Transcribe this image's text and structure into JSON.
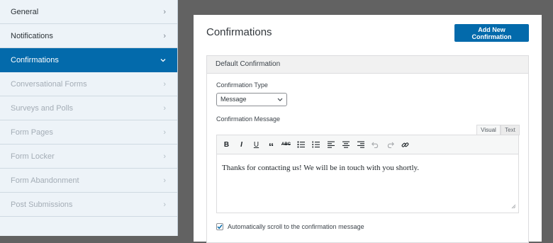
{
  "sidebar": {
    "items": [
      {
        "label": "General",
        "state": "normal"
      },
      {
        "label": "Notifications",
        "state": "normal"
      },
      {
        "label": "Confirmations",
        "state": "active"
      },
      {
        "label": "Conversational Forms",
        "state": "disabled"
      },
      {
        "label": "Surveys and Polls",
        "state": "disabled"
      },
      {
        "label": "Form Pages",
        "state": "disabled"
      },
      {
        "label": "Form Locker",
        "state": "disabled"
      },
      {
        "label": "Form Abandonment",
        "state": "disabled"
      },
      {
        "label": "Post Submissions",
        "state": "disabled"
      }
    ],
    "chevron_right": "›",
    "chevron_down": "⌄"
  },
  "panel": {
    "title": "Confirmations",
    "add_button_label": "Add New Confirmation"
  },
  "confirmation": {
    "header": "Default Confirmation",
    "type_label": "Confirmation Type",
    "type_value": "Message",
    "message_label": "Confirmation Message",
    "tab_visual": "Visual",
    "tab_text": "Text",
    "message_text": "Thanks for contacting us! We will be in touch with you shortly.",
    "autoscroll_label": "Automatically scroll to the confirmation message",
    "autoscroll_checked": true
  },
  "toolbar": {
    "bold": "B",
    "italic": "I",
    "underline": "U",
    "quote": "“",
    "strike": "ABC"
  },
  "colors": {
    "accent": "#036aab",
    "background": "#626262",
    "sidebar_bg": "#edf3f8"
  }
}
